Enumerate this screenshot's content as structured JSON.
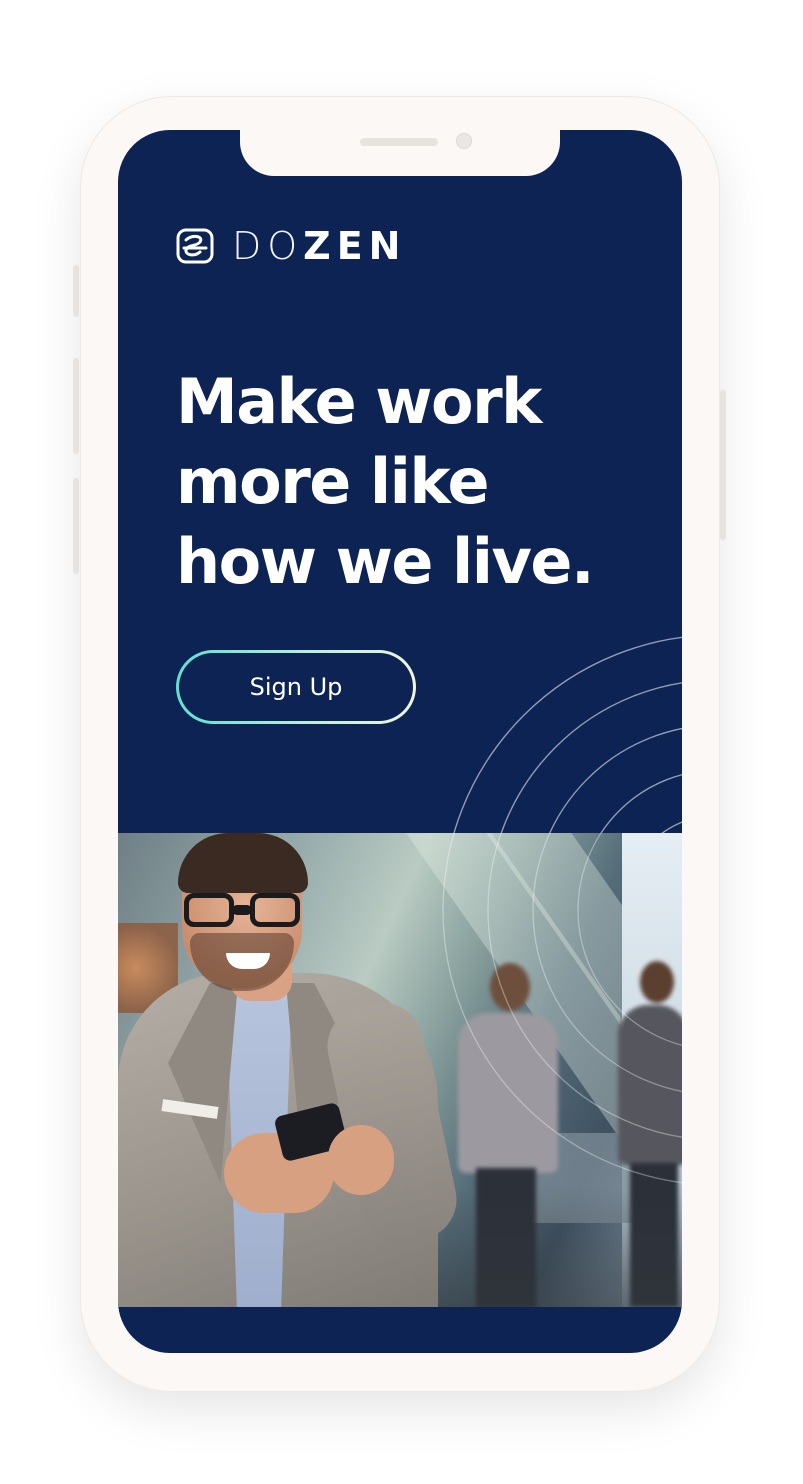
{
  "app": {
    "brand_thin": "DO",
    "brand_bold": "ZEN",
    "logo_icon": "dozen-logo-icon"
  },
  "hero": {
    "headline_line1": "Make work",
    "headline_line2": "more like",
    "headline_line3": "how we live."
  },
  "cta": {
    "signup_label": "Sign Up"
  },
  "colors": {
    "background": "#0c2354",
    "text": "#ffffff",
    "button_border_start": "#5fe0cf",
    "button_border_end": "#eef7dc",
    "device_frame": "#fbf8f6"
  },
  "image": {
    "subject": "smiling man with glasses looking at phone in office"
  }
}
